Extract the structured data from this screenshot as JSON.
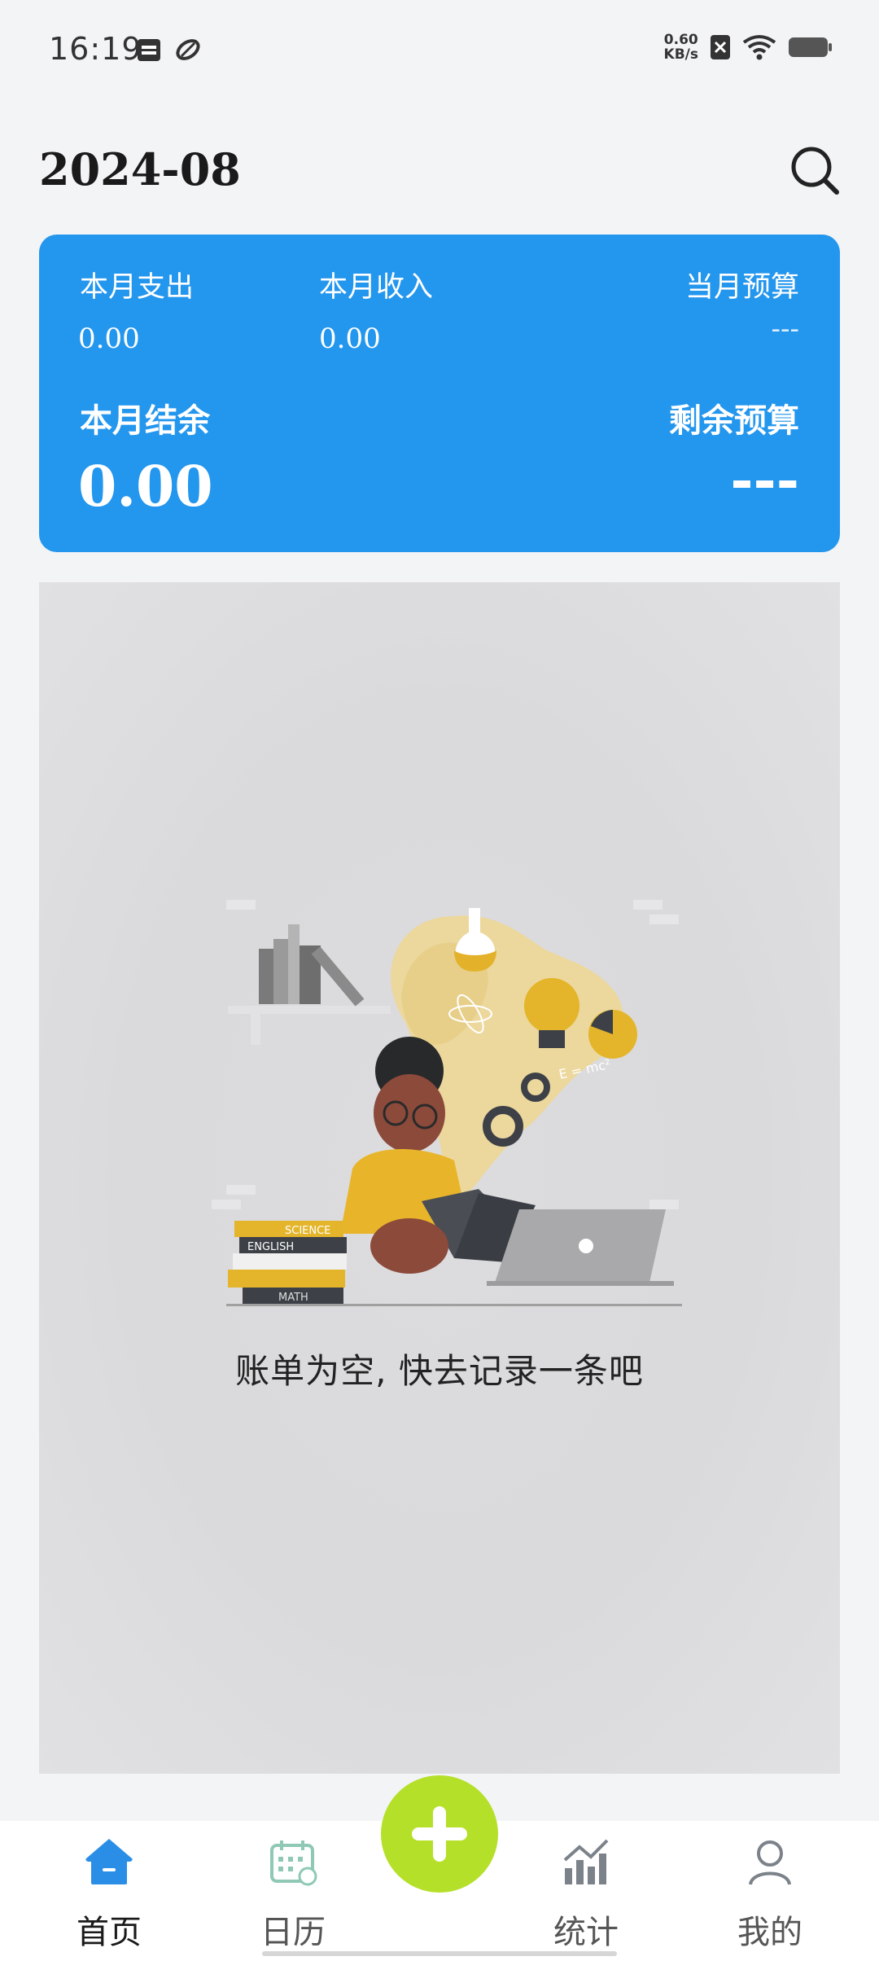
{
  "status_bar": {
    "time": "16:19",
    "net_speed_value": "0.60",
    "net_speed_unit": "KB/s"
  },
  "header": {
    "month": "2024-08"
  },
  "summary": {
    "expense_label": "本月支出",
    "expense_value": "0.00",
    "income_label": "本月收入",
    "income_value": "0.00",
    "budget_label": "当月预算",
    "budget_value": "---",
    "balance_label": "本月结余",
    "balance_value": "0.00",
    "remaining_label": "剩余预算",
    "remaining_value": "---",
    "card_color": "#2396ee"
  },
  "empty_state": {
    "message": "账单为空, 快去记录一条吧",
    "book_labels": {
      "science": "SCIENCE",
      "english": "ENGLISH",
      "math": "MATH"
    },
    "formula": "E = mc²"
  },
  "bottom_nav": {
    "items": [
      {
        "label": "首页",
        "icon": "home-icon",
        "active": true
      },
      {
        "label": "日历",
        "icon": "calendar-icon",
        "active": false
      },
      {
        "label": "统计",
        "icon": "chart-icon",
        "active": false
      },
      {
        "label": "我的",
        "icon": "profile-icon",
        "active": false
      }
    ],
    "add_icon": "plus-icon",
    "accent": "#2a8ee6",
    "add_color": "#b5e02a"
  }
}
